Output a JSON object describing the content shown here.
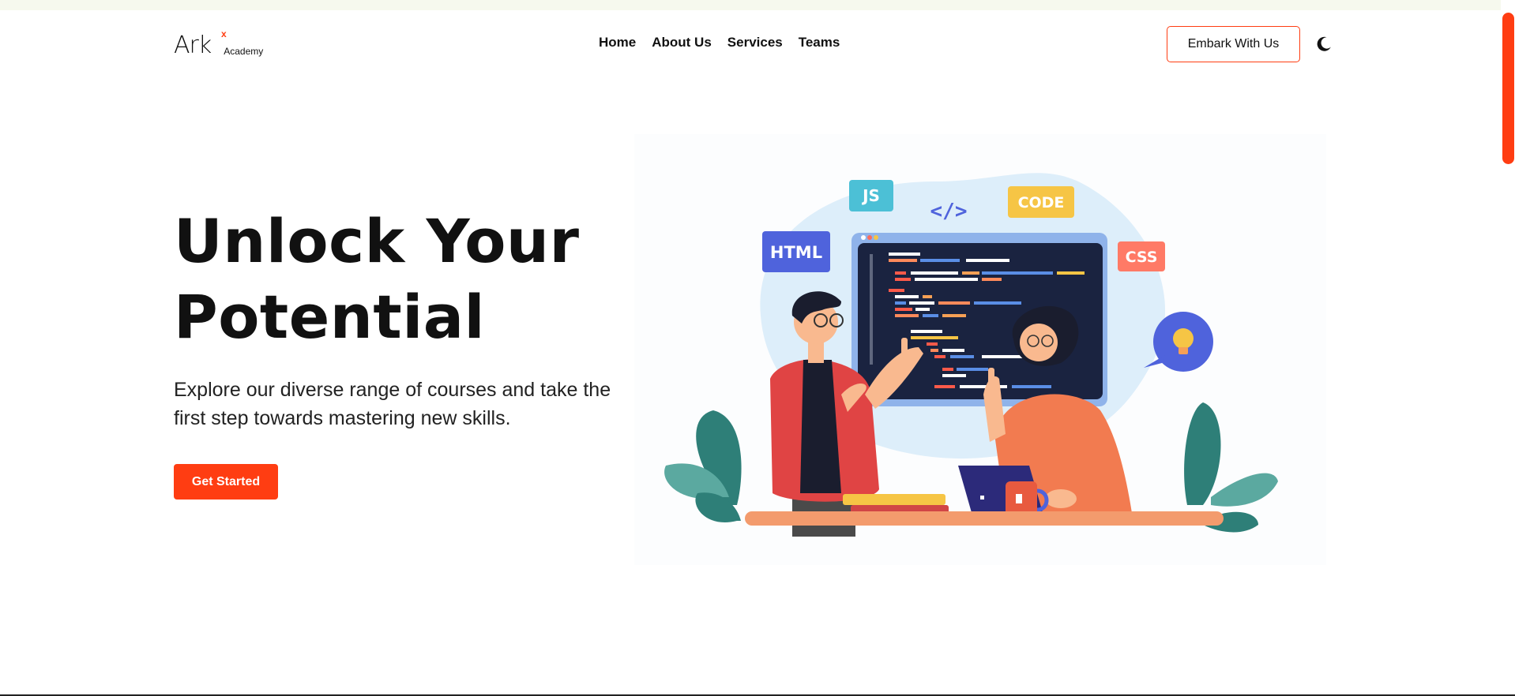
{
  "brand": {
    "name": "Ark",
    "mark": "x",
    "sub": "Academy",
    "accent": "#ff3d12"
  },
  "nav": [
    {
      "label": "Home"
    },
    {
      "label": "About Us"
    },
    {
      "label": "Services"
    },
    {
      "label": "Teams"
    }
  ],
  "header": {
    "cta_label": "Embark With Us",
    "theme_icon": "moon-icon"
  },
  "hero": {
    "title_line1": "Unlock Your",
    "title_line2": "Potential",
    "description": "Explore our diverse range of courses and take the first step towards mastering new skills.",
    "cta_label": "Get Started"
  },
  "illustration": {
    "tags": {
      "js": "JS",
      "html": "HTML",
      "code": "CODE",
      "css": "CSS",
      "tag": "</>"
    }
  }
}
